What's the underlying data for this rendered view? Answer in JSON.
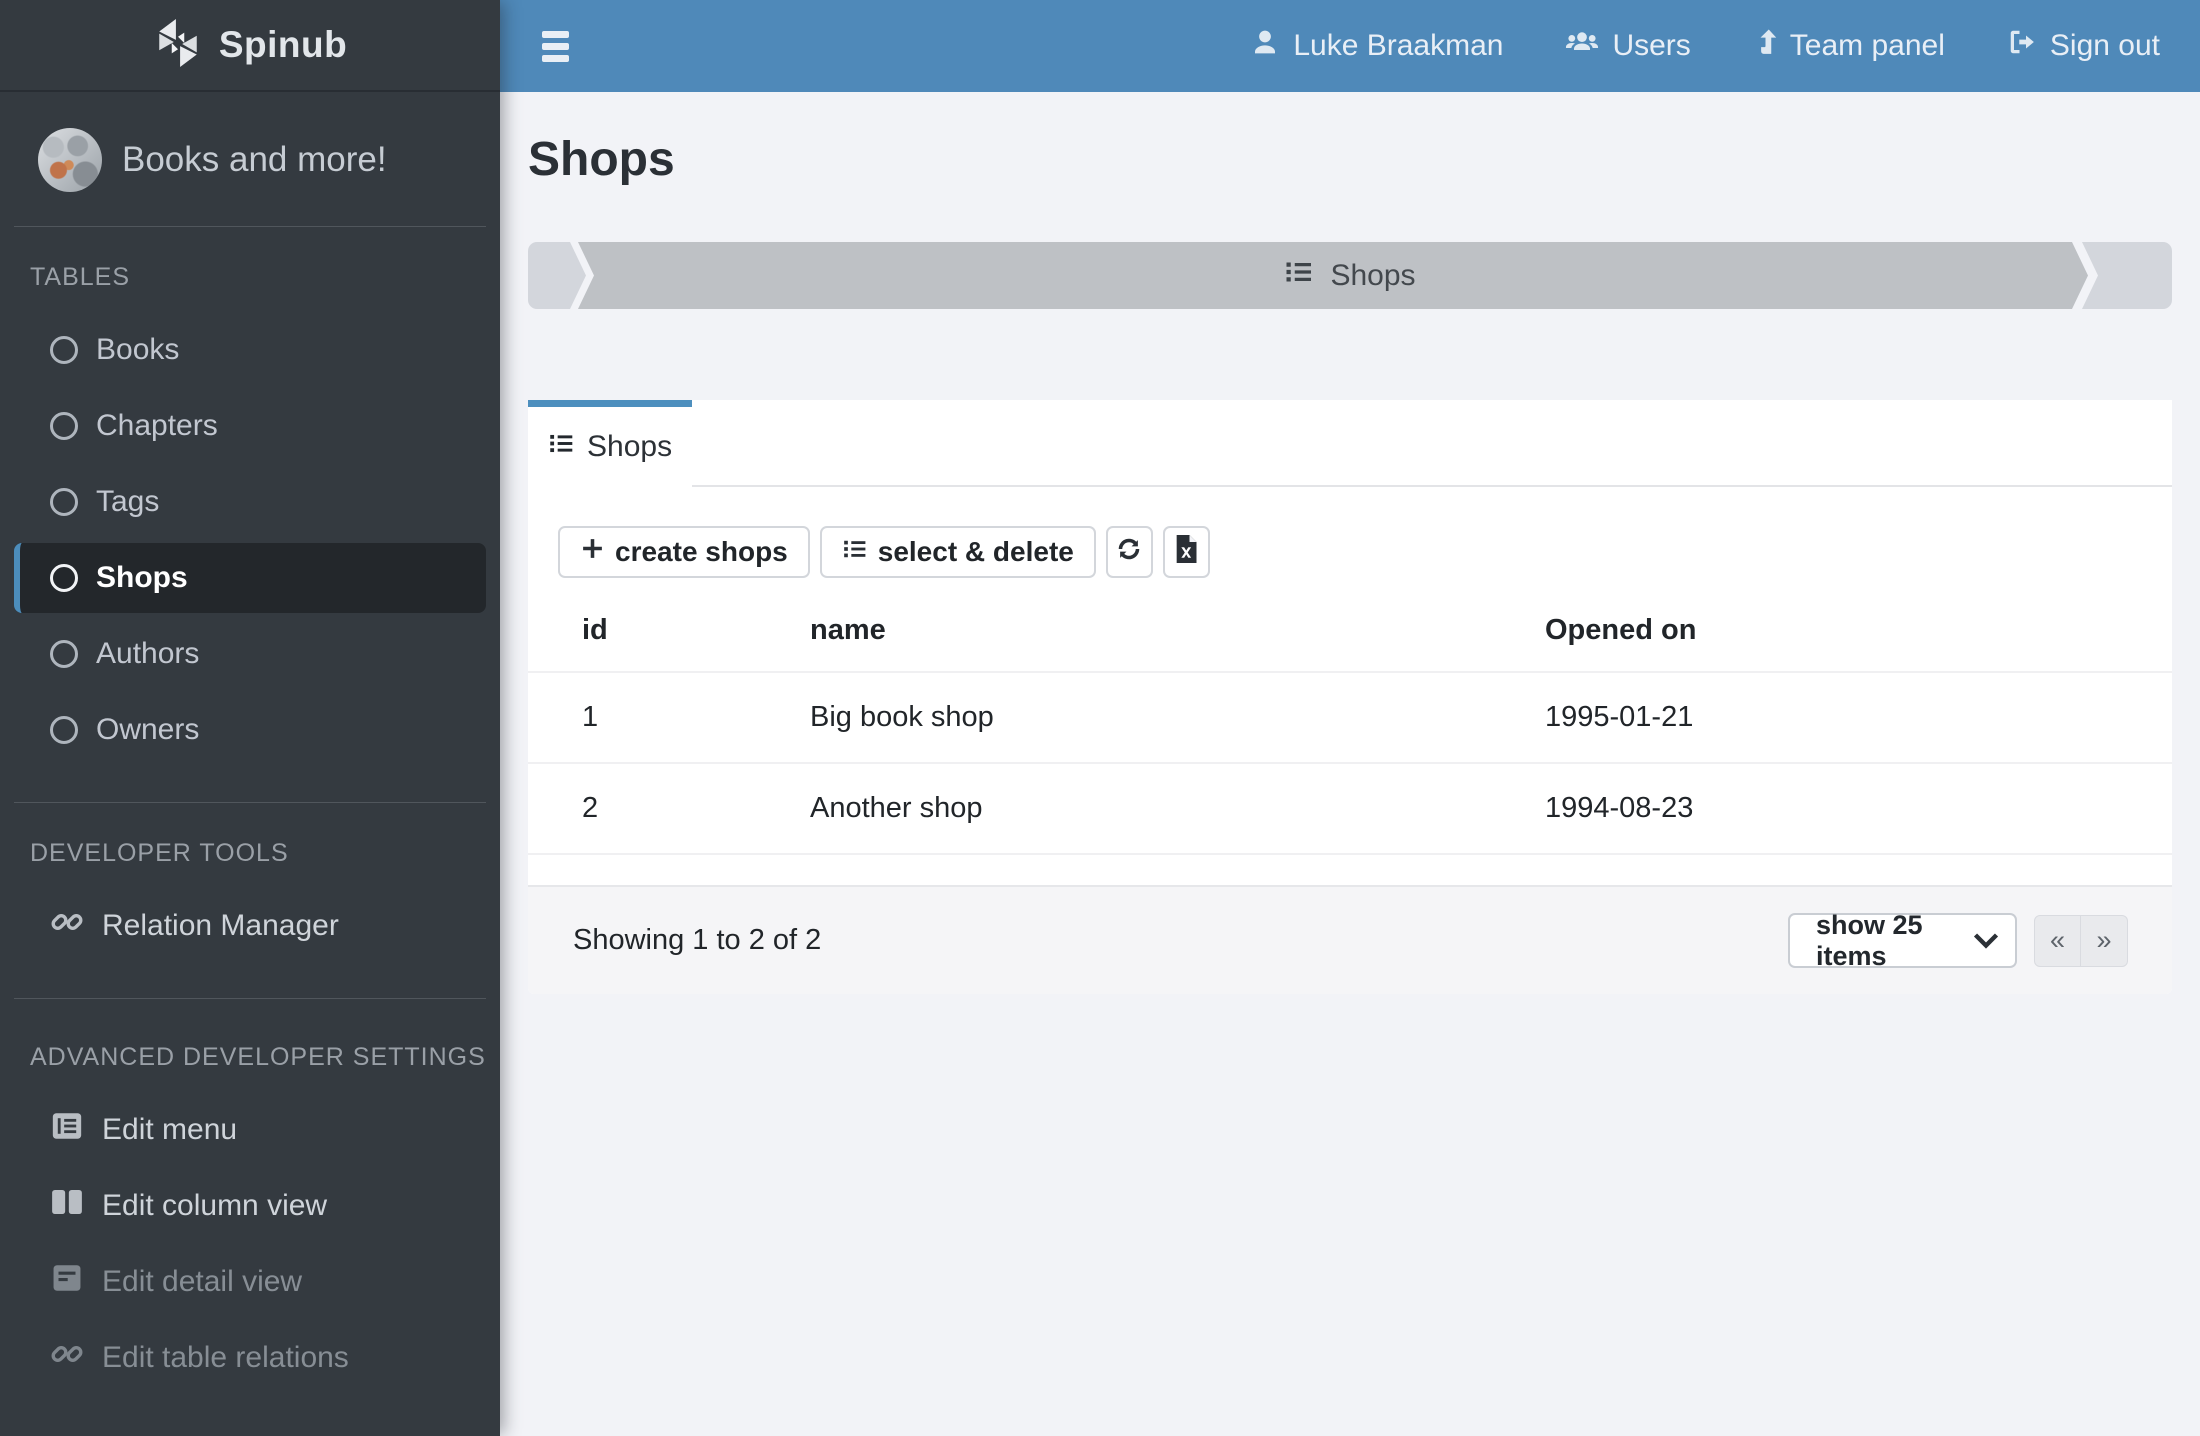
{
  "brand": {
    "name": "Spinub"
  },
  "topbar": {
    "user_label": "Luke Braakman",
    "users_label": "Users",
    "team_panel_label": "Team panel",
    "sign_out_label": "Sign out"
  },
  "sidebar": {
    "workspace_label": "Books and more!",
    "section_tables": "TABLES",
    "items_tables": [
      {
        "label": "Books"
      },
      {
        "label": "Chapters"
      },
      {
        "label": "Tags"
      },
      {
        "label": "Shops",
        "active": true
      },
      {
        "label": "Authors"
      },
      {
        "label": "Owners"
      }
    ],
    "section_devtools": "DEVELOPER TOOLS",
    "items_devtools": [
      {
        "label": "Relation Manager"
      }
    ],
    "section_advanced": "ADVANCED DEVELOPER SETTINGS",
    "items_advanced": [
      {
        "label": "Edit menu"
      },
      {
        "label": "Edit column view"
      },
      {
        "label": "Edit detail view"
      },
      {
        "label": "Edit table relations"
      }
    ]
  },
  "page": {
    "title": "Shops",
    "breadcrumb_label": "Shops",
    "tab_label": "Shops",
    "toolbar": {
      "create_label": "create shops",
      "select_delete_label": "select & delete"
    },
    "table": {
      "headers": [
        "id",
        "name",
        "Opened on"
      ],
      "rows": [
        {
          "id": "1",
          "name": "Big book shop",
          "opened_on": "1995-01-21"
        },
        {
          "id": "2",
          "name": "Another shop",
          "opened_on": "1994-08-23"
        }
      ]
    },
    "footer": {
      "showing_text": "Showing 1 to 2 of 2",
      "page_size_label": "show 25 items",
      "prev_label": "«",
      "next_label": "»"
    }
  },
  "colors": {
    "topbar": "#4f89b9",
    "sidebar": "#343a40",
    "sidebar_active_bg": "#23272b",
    "accent_blue": "#4c8dbc",
    "breadcrumb_mid": "#bec1c5",
    "breadcrumb_ends": "#d3d6dc",
    "page_bg": "#f2f3f7"
  },
  "icons": [
    "pinwheel-logo-icon",
    "menu-icon",
    "user-icon",
    "users-icon",
    "level-up-icon",
    "sign-out-icon",
    "circle-icon",
    "link-icon",
    "list-alt-icon",
    "columns-icon",
    "detail-view-icon",
    "list-icon",
    "plus-icon",
    "refresh-icon",
    "excel-export-icon",
    "chevron-down-icon"
  ]
}
